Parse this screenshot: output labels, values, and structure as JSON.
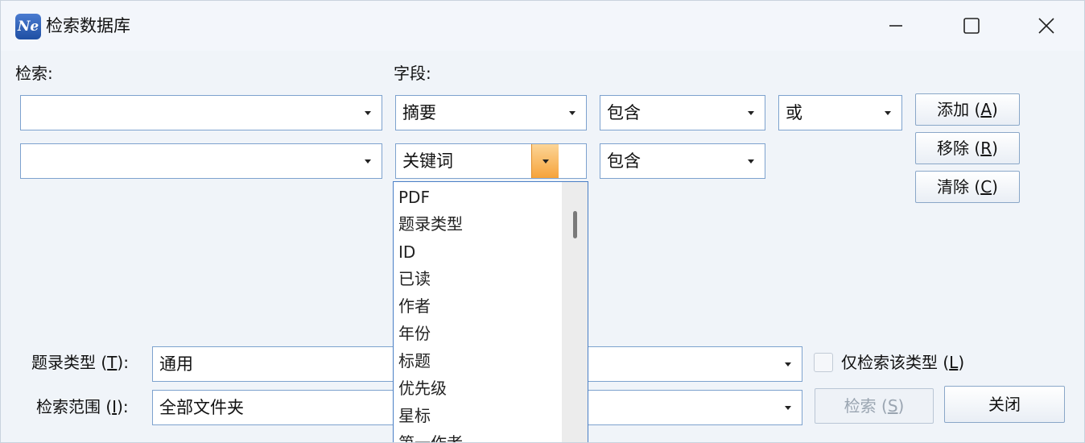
{
  "window": {
    "title": "检索数据库",
    "app_icon_text": "Ne",
    "controls": {
      "minimize_icon": "minimize-icon",
      "maximize_icon": "maximize-icon",
      "close_icon": "close-icon"
    }
  },
  "labels": {
    "search": "检索:",
    "field": "字段:"
  },
  "rows": [
    {
      "search_value": "",
      "field_value": "摘要",
      "operator_value": "包含",
      "logic_value": "或"
    },
    {
      "search_value": "",
      "field_value": "关键词",
      "operator_value": "包含"
    }
  ],
  "buttons": {
    "add": {
      "text": "添加 (",
      "key": "A",
      "end": ")"
    },
    "remove": {
      "text": "移除 (",
      "key": "R",
      "end": ")"
    },
    "clear": {
      "text": "清除 (",
      "key": "C",
      "end": ")"
    },
    "search": {
      "text": "检索 (",
      "key": "S",
      "end": ")"
    },
    "close": "关闭"
  },
  "field_dropdown": {
    "options": [
      "PDF",
      "题录类型",
      "ID",
      "已读",
      "作者",
      "年份",
      "标题",
      "优先级",
      "星标",
      "第一作者"
    ]
  },
  "record_type": {
    "label_pre": "题录类型 (",
    "label_key": "T",
    "label_post": "):",
    "value": "通用"
  },
  "only_type_checkbox": {
    "label_pre": "仅检索该类型 (",
    "label_key": "L",
    "label_post": ")",
    "checked": false
  },
  "scope": {
    "label_pre": "检索范围 (",
    "label_key": "I",
    "label_post": "):",
    "value": "全部文件夹"
  },
  "colors": {
    "accent_border": "#7da2ce",
    "active_arrow": "#f6a33b",
    "background": "#f0f4f9"
  }
}
